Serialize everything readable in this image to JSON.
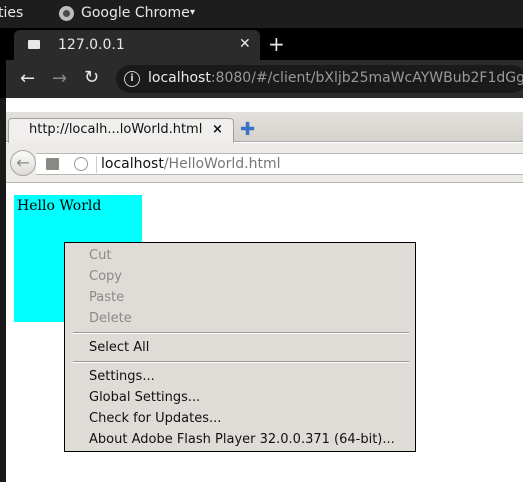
{
  "topbar": {
    "activities": "ties",
    "app_name": "Google Chrome",
    "caret": "▾"
  },
  "chrome": {
    "tab_title": "127.0.0.1",
    "tab_close": "✕",
    "new_tab": "+",
    "back": "←",
    "forward": "→",
    "reload": "↻",
    "info_icon": "i",
    "url_host": "localhost",
    "url_rest": ":8080/#/client/bXljb25maWcAYWBub2F1dGg="
  },
  "firefox": {
    "tab_title": "http://localh...loWorld.html",
    "tab_close": "×",
    "new_tab": "✚",
    "back": "←",
    "url_host": "localhost",
    "url_path": "/HelloWorld.html"
  },
  "flash": {
    "text": "Hello World",
    "bg_color": "#00ffff"
  },
  "context_menu": {
    "items": [
      {
        "label": "Cut",
        "enabled": false
      },
      {
        "label": "Copy",
        "enabled": false
      },
      {
        "label": "Paste",
        "enabled": false
      },
      {
        "label": "Delete",
        "enabled": false
      },
      {
        "label": "Select All",
        "enabled": true
      },
      {
        "label": "Settings...",
        "enabled": true
      },
      {
        "label": "Global Settings...",
        "enabled": true
      },
      {
        "label": "Check for Updates...",
        "enabled": true
      },
      {
        "label": "About Adobe Flash Player 32.0.0.371 (64-bit)...",
        "enabled": true
      }
    ]
  }
}
